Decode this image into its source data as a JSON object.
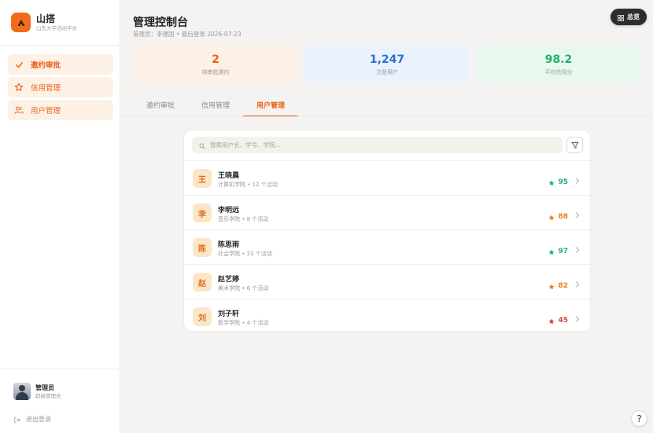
{
  "brand": {
    "name": "山搭",
    "subtitle": "山东大学活动平台"
  },
  "nav": [
    {
      "label": "邀约审批",
      "icon": "check-icon",
      "active": true
    },
    {
      "label": "信用管理",
      "icon": "star-icon",
      "active": false
    },
    {
      "label": "用户管理",
      "icon": "users-icon",
      "active": false
    }
  ],
  "profile": {
    "name": "管理员",
    "role": "超级管理员"
  },
  "logout_label": "退出登录",
  "header": {
    "title": "管理控制台",
    "subtitle": "管理员：李建国 • 最后登录 2026-07-23",
    "overview_label": "总览"
  },
  "stats": [
    {
      "value": "2",
      "label": "待审批邀约",
      "color": "#e8621a",
      "bg": "#fdf0e4"
    },
    {
      "value": "1,247",
      "label": "注册用户",
      "color": "#2f6fd0",
      "bg": "#eaf3fd"
    },
    {
      "value": "98.2",
      "label": "平均信用分",
      "color": "#20b26b",
      "bg": "#e9f8ef"
    }
  ],
  "tabs": [
    {
      "label": "邀约审批",
      "active": false
    },
    {
      "label": "信用管理",
      "active": false
    },
    {
      "label": "用户管理",
      "active": true
    }
  ],
  "search": {
    "placeholder": "搜索用户名、学号、学院...",
    "value": ""
  },
  "users": [
    {
      "avatar": "王",
      "name": "王晓晨",
      "meta": "计算机学院 • 12 个活动",
      "score": "95",
      "score_color": "#20b26b"
    },
    {
      "avatar": "李",
      "name": "李明远",
      "meta": "音乐学院 • 8 个活动",
      "score": "88",
      "score_color": "#ef7d1a"
    },
    {
      "avatar": "陈",
      "name": "陈思雨",
      "meta": "社会学院 • 23 个活动",
      "score": "97",
      "score_color": "#20b26b"
    },
    {
      "avatar": "赵",
      "name": "赵艺婷",
      "meta": "美术学院 • 6 个活动",
      "score": "82",
      "score_color": "#ef7d1a"
    },
    {
      "avatar": "刘",
      "name": "刘子轩",
      "meta": "数学学院 • 4 个活动",
      "score": "45",
      "score_color": "#e23b3b"
    }
  ],
  "help_label": "?"
}
